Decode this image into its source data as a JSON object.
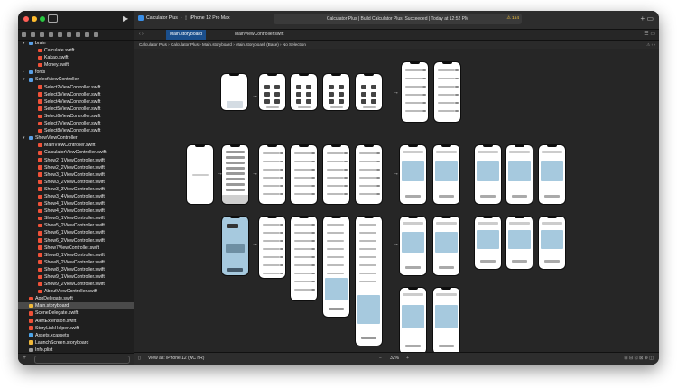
{
  "window": {
    "traffic_lights": [
      "#ff5f57",
      "#febc2e",
      "#28c840"
    ]
  },
  "toolbar": {
    "app_name": "Calculator Plus",
    "device": "iPhone 12 Pro Max",
    "status": "Calculator Plus | Build Calculator Plus: Succeeded | Today at 12:52 PM",
    "warnings": "⚠ 154"
  },
  "tabs": [
    {
      "label": "Main.storyboard",
      "active": true
    },
    {
      "label": "MainViewController.swift",
      "active": false
    }
  ],
  "jumpbar": {
    "crumbs": [
      "Calculator Plus",
      "Calculator Plus",
      "Main.storyboard",
      "Main.storyboard (Base)",
      "No Selection"
    ]
  },
  "sidebar": {
    "items": [
      {
        "label": "brain",
        "indent": 1,
        "type": "folder",
        "open": true
      },
      {
        "label": "Calculate.swift",
        "indent": 2,
        "type": "swift"
      },
      {
        "label": "Kakao.swift",
        "indent": 2,
        "type": "swift"
      },
      {
        "label": "Money.swift",
        "indent": 2,
        "type": "swift"
      },
      {
        "label": "fonts",
        "indent": 1,
        "type": "folder",
        "open": false
      },
      {
        "label": "SelectViewController",
        "indent": 1,
        "type": "folder",
        "open": true
      },
      {
        "label": "Select2ViewController.swift",
        "indent": 2,
        "type": "swift"
      },
      {
        "label": "Select3ViewController.swift",
        "indent": 2,
        "type": "swift"
      },
      {
        "label": "Select4ViewController.swift",
        "indent": 2,
        "type": "swift"
      },
      {
        "label": "Select5ViewController.swift",
        "indent": 2,
        "type": "swift"
      },
      {
        "label": "Select6ViewController.swift",
        "indent": 2,
        "type": "swift"
      },
      {
        "label": "Select7ViewController.swift",
        "indent": 2,
        "type": "swift"
      },
      {
        "label": "Select8ViewController.swift",
        "indent": 2,
        "type": "swift"
      },
      {
        "label": "ShowViewController",
        "indent": 1,
        "type": "folder",
        "open": true
      },
      {
        "label": "MainViewController.swift",
        "indent": 2,
        "type": "swift"
      },
      {
        "label": "CalculatorViewController.swift",
        "indent": 2,
        "type": "swift"
      },
      {
        "label": "Show2_1ViewController.swift",
        "indent": 2,
        "type": "swift"
      },
      {
        "label": "Show2_2ViewController.swift",
        "indent": 2,
        "type": "swift"
      },
      {
        "label": "Show3_1ViewController.swift",
        "indent": 2,
        "type": "swift"
      },
      {
        "label": "Show3_2ViewController.swift",
        "indent": 2,
        "type": "swift"
      },
      {
        "label": "Show3_3ViewController.swift",
        "indent": 2,
        "type": "swift"
      },
      {
        "label": "Show3_4ViewController.swift",
        "indent": 2,
        "type": "swift"
      },
      {
        "label": "Show4_1ViewController.swift",
        "indent": 2,
        "type": "swift"
      },
      {
        "label": "Show4_2ViewController.swift",
        "indent": 2,
        "type": "swift"
      },
      {
        "label": "Show5_1ViewController.swift",
        "indent": 2,
        "type": "swift"
      },
      {
        "label": "Show5_2ViewController.swift",
        "indent": 2,
        "type": "swift"
      },
      {
        "label": "Show6_1ViewController.swift",
        "indent": 2,
        "type": "swift"
      },
      {
        "label": "Show6_2ViewController.swift",
        "indent": 2,
        "type": "swift"
      },
      {
        "label": "Show7ViewController.swift",
        "indent": 2,
        "type": "swift"
      },
      {
        "label": "Show8_1ViewController.swift",
        "indent": 2,
        "type": "swift"
      },
      {
        "label": "Show8_2ViewController.swift",
        "indent": 2,
        "type": "swift"
      },
      {
        "label": "Show8_3ViewController.swift",
        "indent": 2,
        "type": "swift"
      },
      {
        "label": "Show9_1ViewController.swift",
        "indent": 2,
        "type": "swift"
      },
      {
        "label": "Show9_2ViewController.swift",
        "indent": 2,
        "type": "swift"
      },
      {
        "label": "AboutViewController.swift",
        "indent": 2,
        "type": "swift"
      },
      {
        "label": "AppDelegate.swift",
        "indent": 1,
        "type": "swift"
      },
      {
        "label": "Main.storyboard",
        "indent": 1,
        "type": "storyboard",
        "selected": true
      },
      {
        "label": "SceneDelegate.swift",
        "indent": 1,
        "type": "swift"
      },
      {
        "label": "AlertExtension.swift",
        "indent": 1,
        "type": "swift"
      },
      {
        "label": "StoryLinkHelper.swift",
        "indent": 1,
        "type": "swift"
      },
      {
        "label": "Assets.xcassets",
        "indent": 1,
        "type": "assets"
      },
      {
        "label": "LaunchScreen.storyboard",
        "indent": 1,
        "type": "storyboard"
      },
      {
        "label": "Info.plist",
        "indent": 1,
        "type": "plist"
      }
    ]
  },
  "bottombar": {
    "view_as": "View as: iPhone 12 (wC hR)",
    "zoom": "32%"
  },
  "colors": {
    "swift": "#f05138",
    "folder": "#5aa0e6",
    "storyboard": "#f0b93a",
    "assets": "#4da4e8",
    "plist": "#9a9a9a",
    "accent_blue": "#a6c9de"
  },
  "icons": {
    "run": "play-icon",
    "sidebar_toggle": "sidebar-toggle-icon",
    "add": "plus-icon",
    "warning": "warning-icon"
  }
}
